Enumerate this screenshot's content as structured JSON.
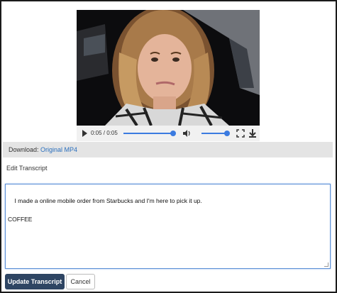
{
  "video": {
    "current_time": "0:05",
    "duration": "0:05",
    "time_display": "0:05 / 0:05",
    "progress": 1.0,
    "volume": 1.0,
    "play_icon": "play-icon",
    "volume_icon": "speaker-icon",
    "fullscreen_icon": "fullscreen-icon",
    "download_icon": "download-icon",
    "accent_color": "#3b7be0"
  },
  "download": {
    "label": "Download:",
    "link_text": "Original MP4"
  },
  "editor": {
    "label": "Edit Transcript",
    "transcript_text": "I made a online mobile order from Starbucks and I'm here to pick it up.\n\nCOFFEE"
  },
  "buttons": {
    "update_label": "Update Transcript",
    "cancel_label": "Cancel"
  }
}
